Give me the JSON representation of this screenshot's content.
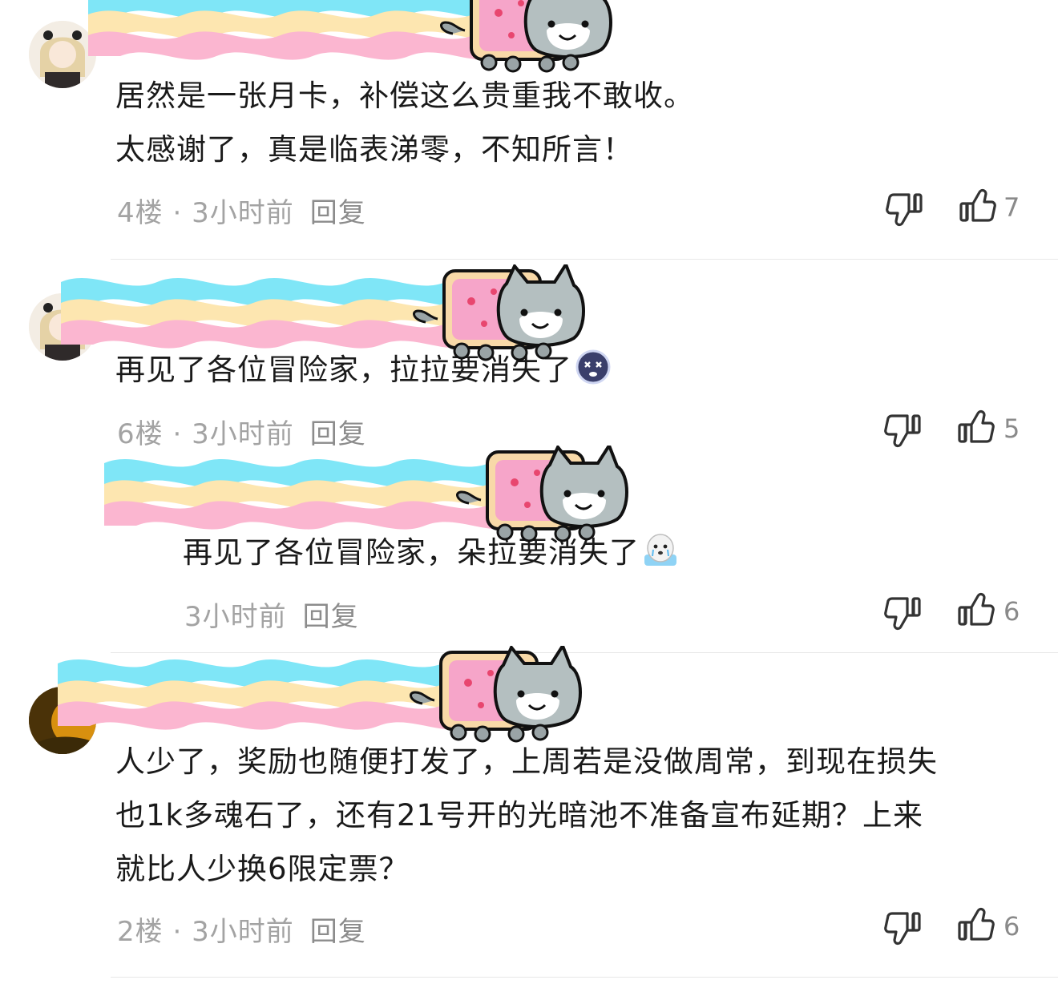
{
  "comments": [
    {
      "text_lines": [
        "居然是一张月卡，补偿这么贵重我不敢收。",
        "太感谢了，真是临表涕零，不知所言！"
      ],
      "floor": "4楼",
      "time": "3小时前",
      "reply": "回复",
      "likes": "7"
    },
    {
      "text_lines": [
        "再见了各位冒险家，拉拉要消失了"
      ],
      "floor": "6楼",
      "time": "3小时前",
      "reply": "回复",
      "likes": "5",
      "emoji": "dizzy-face-emoji"
    },
    {
      "text_lines": [
        "再见了各位冒险家，朵拉要消失了"
      ],
      "floor": "",
      "time": "3小时前",
      "reply": "回复",
      "likes": "6",
      "emoji": "crying-seal-emoji"
    },
    {
      "text_lines": [
        "人少了，奖励也随便打发了，上周若是没做周常，到现在损失",
        "也1k多魂石了，还有21号开的光暗池不准备宣布延期？上来",
        "就比人少换6限定票？"
      ],
      "floor": "2楼",
      "time": "3小时前",
      "reply": "回复",
      "likes": "6"
    }
  ],
  "separator": " · ",
  "icons": {
    "dislike": "thumbs-down-icon",
    "like": "thumbs-up-icon",
    "sticker": "nyan-cat-sticker"
  },
  "colors": {
    "text": "#1a1a1a",
    "meta": "#a3a3a3",
    "rainbow_blue": "#7fe6f7",
    "rainbow_yellow": "#fde6b0",
    "rainbow_pink": "#fbb6d0"
  }
}
